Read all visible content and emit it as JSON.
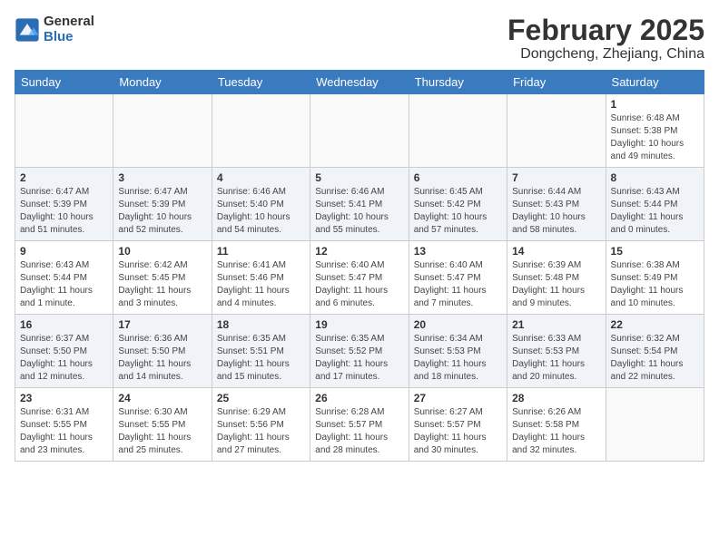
{
  "header": {
    "logo_general": "General",
    "logo_blue": "Blue",
    "month_year": "February 2025",
    "location": "Dongcheng, Zhejiang, China"
  },
  "weekdays": [
    "Sunday",
    "Monday",
    "Tuesday",
    "Wednesday",
    "Thursday",
    "Friday",
    "Saturday"
  ],
  "weeks": [
    [
      {
        "day": "",
        "info": ""
      },
      {
        "day": "",
        "info": ""
      },
      {
        "day": "",
        "info": ""
      },
      {
        "day": "",
        "info": ""
      },
      {
        "day": "",
        "info": ""
      },
      {
        "day": "",
        "info": ""
      },
      {
        "day": "1",
        "info": "Sunrise: 6:48 AM\nSunset: 5:38 PM\nDaylight: 10 hours\nand 49 minutes."
      }
    ],
    [
      {
        "day": "2",
        "info": "Sunrise: 6:47 AM\nSunset: 5:39 PM\nDaylight: 10 hours\nand 51 minutes."
      },
      {
        "day": "3",
        "info": "Sunrise: 6:47 AM\nSunset: 5:39 PM\nDaylight: 10 hours\nand 52 minutes."
      },
      {
        "day": "4",
        "info": "Sunrise: 6:46 AM\nSunset: 5:40 PM\nDaylight: 10 hours\nand 54 minutes."
      },
      {
        "day": "5",
        "info": "Sunrise: 6:46 AM\nSunset: 5:41 PM\nDaylight: 10 hours\nand 55 minutes."
      },
      {
        "day": "6",
        "info": "Sunrise: 6:45 AM\nSunset: 5:42 PM\nDaylight: 10 hours\nand 57 minutes."
      },
      {
        "day": "7",
        "info": "Sunrise: 6:44 AM\nSunset: 5:43 PM\nDaylight: 10 hours\nand 58 minutes."
      },
      {
        "day": "8",
        "info": "Sunrise: 6:43 AM\nSunset: 5:44 PM\nDaylight: 11 hours\nand 0 minutes."
      }
    ],
    [
      {
        "day": "9",
        "info": "Sunrise: 6:43 AM\nSunset: 5:44 PM\nDaylight: 11 hours\nand 1 minute."
      },
      {
        "day": "10",
        "info": "Sunrise: 6:42 AM\nSunset: 5:45 PM\nDaylight: 11 hours\nand 3 minutes."
      },
      {
        "day": "11",
        "info": "Sunrise: 6:41 AM\nSunset: 5:46 PM\nDaylight: 11 hours\nand 4 minutes."
      },
      {
        "day": "12",
        "info": "Sunrise: 6:40 AM\nSunset: 5:47 PM\nDaylight: 11 hours\nand 6 minutes."
      },
      {
        "day": "13",
        "info": "Sunrise: 6:40 AM\nSunset: 5:47 PM\nDaylight: 11 hours\nand 7 minutes."
      },
      {
        "day": "14",
        "info": "Sunrise: 6:39 AM\nSunset: 5:48 PM\nDaylight: 11 hours\nand 9 minutes."
      },
      {
        "day": "15",
        "info": "Sunrise: 6:38 AM\nSunset: 5:49 PM\nDaylight: 11 hours\nand 10 minutes."
      }
    ],
    [
      {
        "day": "16",
        "info": "Sunrise: 6:37 AM\nSunset: 5:50 PM\nDaylight: 11 hours\nand 12 minutes."
      },
      {
        "day": "17",
        "info": "Sunrise: 6:36 AM\nSunset: 5:50 PM\nDaylight: 11 hours\nand 14 minutes."
      },
      {
        "day": "18",
        "info": "Sunrise: 6:35 AM\nSunset: 5:51 PM\nDaylight: 11 hours\nand 15 minutes."
      },
      {
        "day": "19",
        "info": "Sunrise: 6:35 AM\nSunset: 5:52 PM\nDaylight: 11 hours\nand 17 minutes."
      },
      {
        "day": "20",
        "info": "Sunrise: 6:34 AM\nSunset: 5:53 PM\nDaylight: 11 hours\nand 18 minutes."
      },
      {
        "day": "21",
        "info": "Sunrise: 6:33 AM\nSunset: 5:53 PM\nDaylight: 11 hours\nand 20 minutes."
      },
      {
        "day": "22",
        "info": "Sunrise: 6:32 AM\nSunset: 5:54 PM\nDaylight: 11 hours\nand 22 minutes."
      }
    ],
    [
      {
        "day": "23",
        "info": "Sunrise: 6:31 AM\nSunset: 5:55 PM\nDaylight: 11 hours\nand 23 minutes."
      },
      {
        "day": "24",
        "info": "Sunrise: 6:30 AM\nSunset: 5:55 PM\nDaylight: 11 hours\nand 25 minutes."
      },
      {
        "day": "25",
        "info": "Sunrise: 6:29 AM\nSunset: 5:56 PM\nDaylight: 11 hours\nand 27 minutes."
      },
      {
        "day": "26",
        "info": "Sunrise: 6:28 AM\nSunset: 5:57 PM\nDaylight: 11 hours\nand 28 minutes."
      },
      {
        "day": "27",
        "info": "Sunrise: 6:27 AM\nSunset: 5:57 PM\nDaylight: 11 hours\nand 30 minutes."
      },
      {
        "day": "28",
        "info": "Sunrise: 6:26 AM\nSunset: 5:58 PM\nDaylight: 11 hours\nand 32 minutes."
      },
      {
        "day": "",
        "info": ""
      }
    ]
  ]
}
